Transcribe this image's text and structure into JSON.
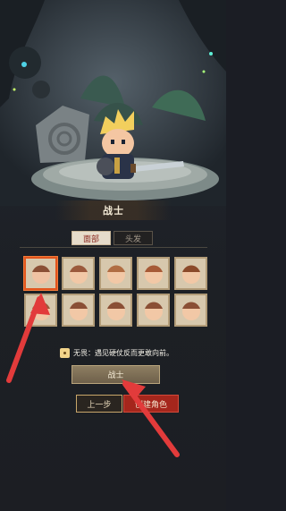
{
  "character": {
    "class_title": "战士"
  },
  "tabs": [
    {
      "label": "面部",
      "active": true
    },
    {
      "label": "头发",
      "active": false
    }
  ],
  "portraits": {
    "count": 10,
    "selected_index": 0
  },
  "trait": {
    "name": "无畏：",
    "description": "遇见硬仗反而更敢向前。"
  },
  "class_select": {
    "value": "战士"
  },
  "buttons": {
    "prev": "上一步",
    "create": "创建角色"
  },
  "colors": {
    "accent_red": "#a5261c",
    "highlight_orange": "#e2551d",
    "parchment": "#d7c8ad"
  }
}
